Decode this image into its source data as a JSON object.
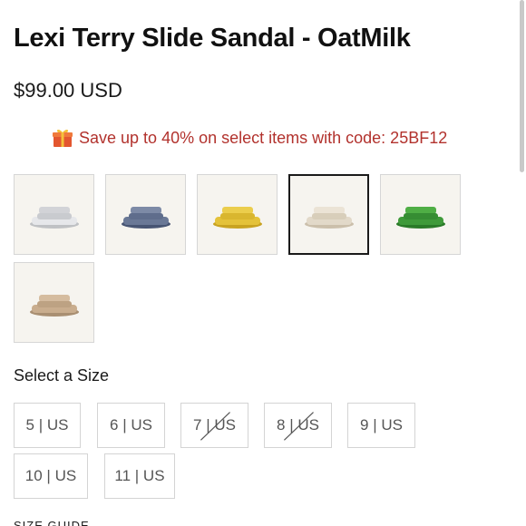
{
  "product": {
    "title": "Lexi Terry Slide Sandal - OatMilk",
    "price": "$99.00 USD"
  },
  "promo": {
    "icon": "gift-icon",
    "text": "Save up to 40% on select items with code: 25BF12",
    "color": "#b2322d"
  },
  "swatches": [
    {
      "name": "silver",
      "color": "#d9dadd",
      "selected": false
    },
    {
      "name": "denim",
      "color": "#6a7896",
      "selected": false
    },
    {
      "name": "yellow",
      "color": "#e4c23a",
      "selected": false
    },
    {
      "name": "oatmilk",
      "color": "#ddd3c2",
      "selected": true
    },
    {
      "name": "green",
      "color": "#3f9a3a",
      "selected": false
    },
    {
      "name": "tan",
      "color": "#c9ad8e",
      "selected": false
    }
  ],
  "sizes": {
    "heading": "Select a Size",
    "options": [
      {
        "label": "5 | US",
        "available": true
      },
      {
        "label": "6 | US",
        "available": true
      },
      {
        "label": "7 | US",
        "available": false
      },
      {
        "label": "8 | US",
        "available": false
      },
      {
        "label": "9 | US",
        "available": true
      },
      {
        "label": "10 | US",
        "available": true
      },
      {
        "label": "11 | US",
        "available": true
      }
    ]
  },
  "size_guide": "SIZE GUIDE"
}
